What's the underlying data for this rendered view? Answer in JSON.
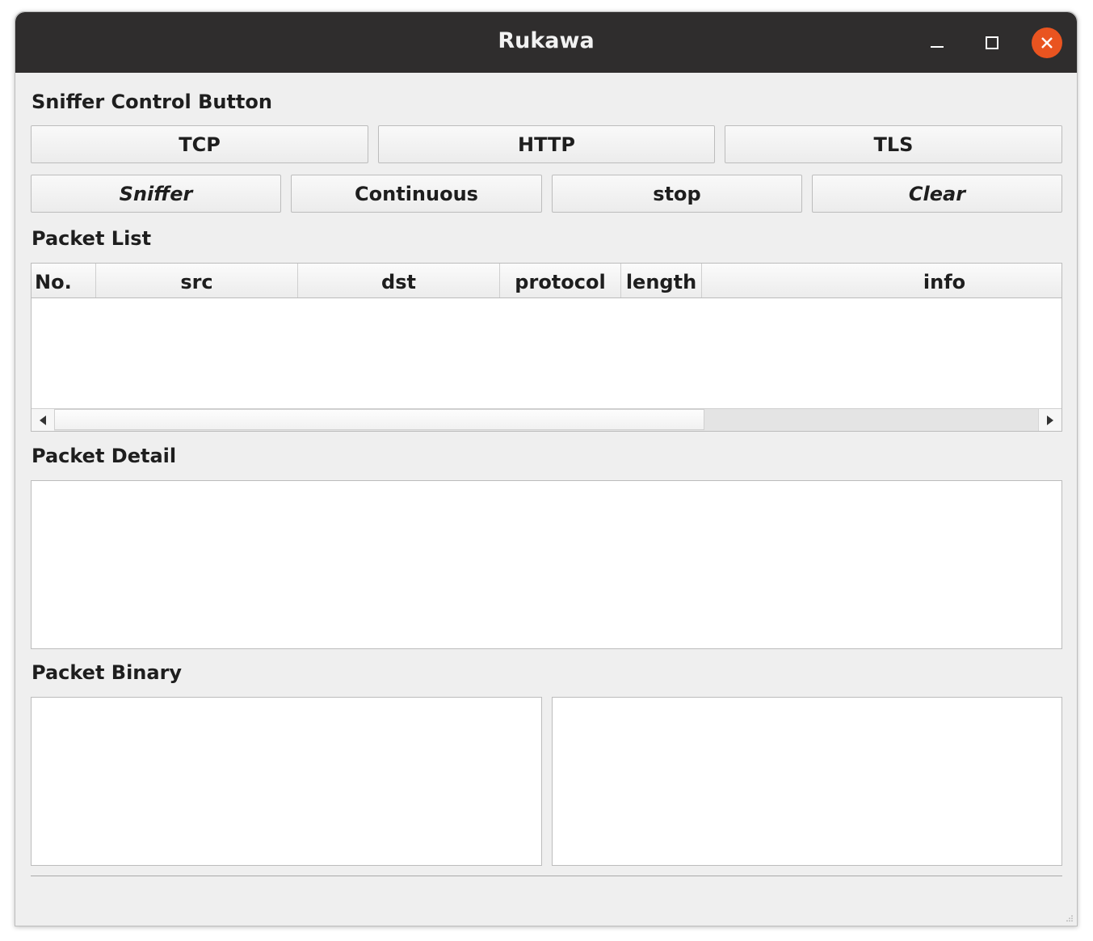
{
  "window": {
    "title": "Rukawa",
    "controls": {
      "minimize": "–",
      "maximize": "□",
      "close": "✕"
    }
  },
  "controls_section": {
    "label": "Sniffer Control Button",
    "row1": [
      "TCP",
      "HTTP",
      "TLS"
    ],
    "row2": [
      "Sniffer",
      "Continuous",
      "stop",
      "Clear"
    ]
  },
  "packet_list": {
    "label": "Packet List",
    "columns": [
      "No.",
      "src",
      "dst",
      "protocol",
      "length",
      "info"
    ],
    "rows": [],
    "hscroll_position": 0,
    "hscroll_visible_fraction": 0.66
  },
  "packet_detail": {
    "label": "Packet Detail",
    "content": ""
  },
  "packet_binary": {
    "label": "Packet Binary",
    "hex": "",
    "ascii": ""
  },
  "colors": {
    "titlebar": "#2f2d2d",
    "close_button": "#e95420",
    "window_bg": "#efefef"
  }
}
